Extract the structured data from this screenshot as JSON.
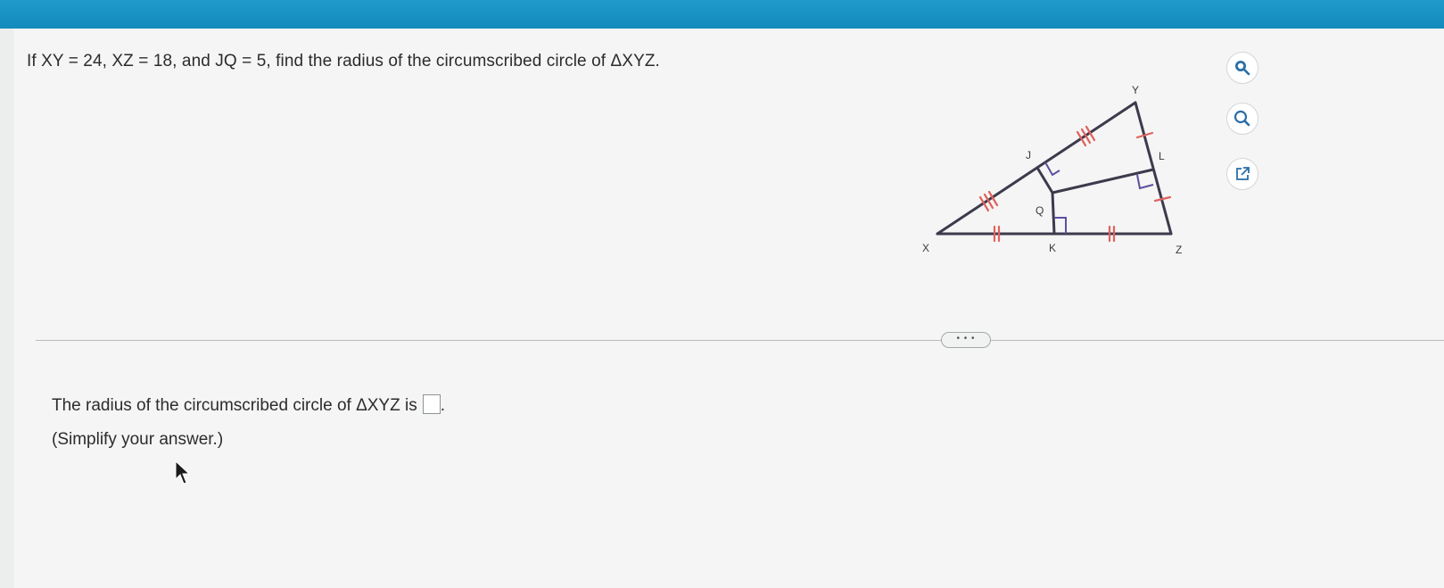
{
  "question": {
    "text": "If XY = 24, XZ = 18, and JQ = 5, find the radius of the circumscribed circle of ΔXYZ."
  },
  "diagram": {
    "labels": {
      "X": "X",
      "Y": "Y",
      "Z": "Z",
      "J": "J",
      "K": "K",
      "L": "L",
      "Q": "Q"
    },
    "tick_color": "#e0625e",
    "line_color": "#3d3a4d"
  },
  "tools": {
    "zoom_in": "zoom-in-icon",
    "zoom_out": "zoom-out-icon",
    "popout": "popout-icon"
  },
  "more_button": {
    "label": "• • •"
  },
  "answer": {
    "prefix": "The radius of the circumscribed circle of ΔXYZ is",
    "suffix": ".",
    "hint": "(Simplify your answer.)"
  }
}
